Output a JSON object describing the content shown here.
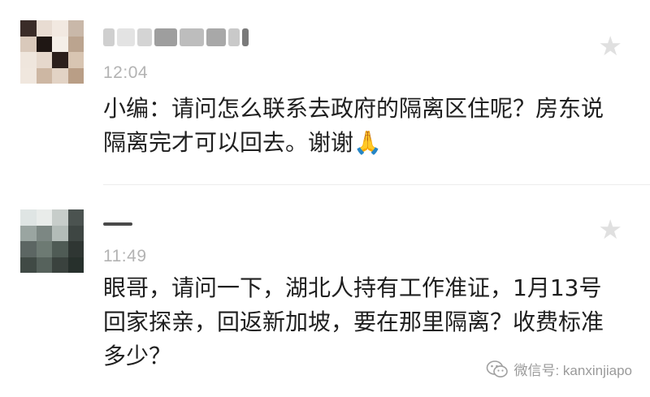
{
  "comments": [
    {
      "time": "12:04",
      "text": "小编：请问怎么联系去政府的隔离区住呢？房东说隔离完才可以回去。谢谢🙏",
      "avatar_colors": [
        "#3a2c28",
        "#e8dcd2",
        "#f2e9e1",
        "#c9b8a9",
        "#d9c9bb",
        "#1f1714",
        "#f5efe8",
        "#bba48f",
        "#efe6dd",
        "#e6d8cc",
        "#2c201c",
        "#d8c5b2",
        "#f0e7de",
        "#cdb7a3",
        "#e2d3c5",
        "#b99e86"
      ]
    },
    {
      "time": "11:49",
      "text": "眼哥，请问一下，湖北人持有工作准证，1月13号回家探亲，回返新加坡，要在那里隔离？收费标准多少？",
      "avatar_colors": [
        "#dfe5e4",
        "#e9ecea",
        "#c7cdca",
        "#4b5350",
        "#9aa5a1",
        "#7c8783",
        "#b3bcb8",
        "#3e4643",
        "#5c6663",
        "#6d7a73",
        "#4f5b55",
        "#2f3633",
        "#404a45",
        "#56625c",
        "#3a423e",
        "#27302c"
      ]
    }
  ],
  "watermark": {
    "text": "微信号: kanxinjiapo",
    "icon": "wechat-logo-icon"
  },
  "icons": {
    "star": "star-icon"
  }
}
